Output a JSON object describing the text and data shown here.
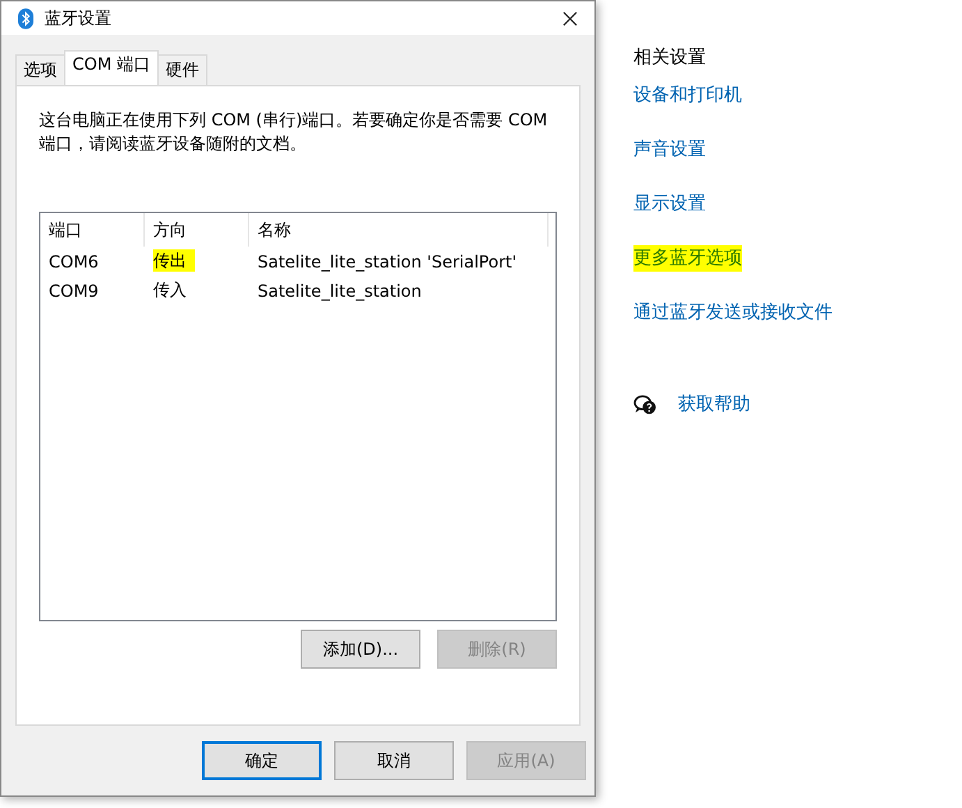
{
  "dialog": {
    "title": "蓝牙设置",
    "tabs": [
      {
        "label": "选项",
        "selected": false
      },
      {
        "label": "COM 端口",
        "selected": true
      },
      {
        "label": "硬件",
        "selected": false
      }
    ],
    "description": "这台电脑正在使用下列 COM (串行)端口。若要确定你是否需要 COM 端口，请阅读蓝牙设备随附的文档。",
    "table": {
      "columns": [
        "端口",
        "方向",
        "名称"
      ],
      "rows": [
        {
          "port": "COM6",
          "direction": "传出",
          "direction_highlighted": true,
          "name": "Satelite_lite_station 'SerialPort'"
        },
        {
          "port": "COM9",
          "direction": "传入",
          "direction_highlighted": false,
          "name": "Satelite_lite_station"
        }
      ]
    },
    "list_buttons": [
      {
        "label": "添加(D)...",
        "disabled": false
      },
      {
        "label": "删除(R)",
        "disabled": true
      }
    ],
    "footer_buttons": [
      {
        "label": "确定",
        "disabled": false,
        "default": true
      },
      {
        "label": "取消",
        "disabled": false,
        "default": false
      },
      {
        "label": "应用(A)",
        "disabled": true,
        "default": false
      }
    ]
  },
  "related_settings": {
    "heading": "相关设置",
    "links": [
      {
        "label": "设备和打印机",
        "highlighted": false
      },
      {
        "label": "声音设置",
        "highlighted": false
      },
      {
        "label": "显示设置",
        "highlighted": false
      },
      {
        "label": "更多蓝牙选项",
        "highlighted": true
      },
      {
        "label": "通过蓝牙发送或接收文件",
        "highlighted": false
      }
    ]
  },
  "help": {
    "label": "获取帮助"
  }
}
